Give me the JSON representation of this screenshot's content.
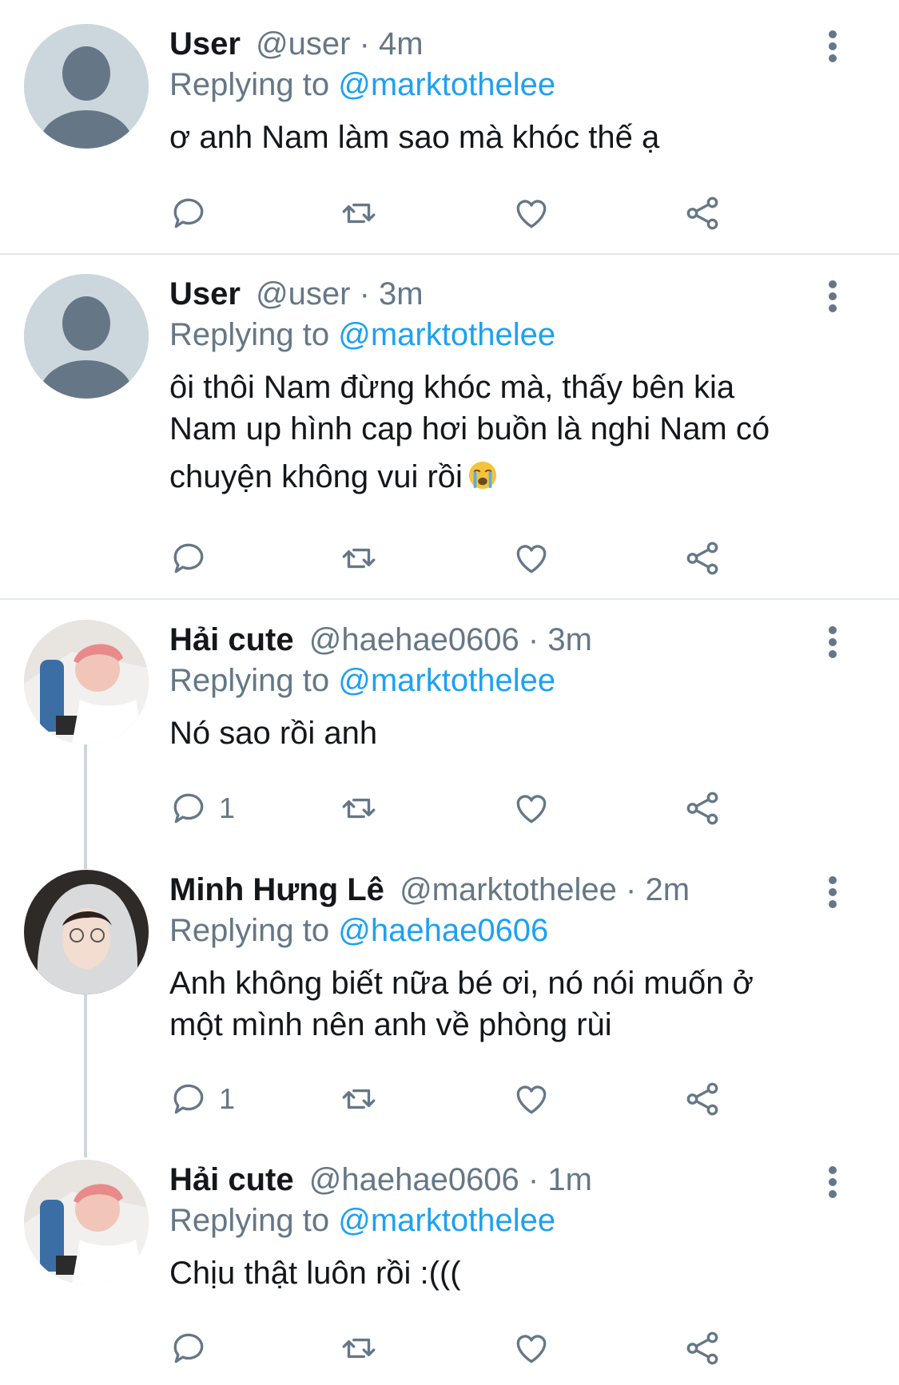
{
  "colors": {
    "mention": "#1da1f2",
    "secondary": "#657786",
    "divider": "#e1e8ed",
    "thread_line": "#ccd6dd"
  },
  "tweets": [
    {
      "name": "User",
      "handle": "@user",
      "sep": " · ",
      "time": "4m",
      "replying_prefix": "Replying to ",
      "replying_to": "@marktothelee",
      "text_lines": [
        "ơ anh Nam làm sao mà khóc thế ạ"
      ],
      "reply_count": "",
      "avatar_icon": "default-avatar-icon"
    },
    {
      "name": "User",
      "handle": "@user",
      "sep": " · ",
      "time": "3m",
      "replying_prefix": "Replying to ",
      "replying_to": "@marktothelee",
      "text_lines": [
        "ôi thôi Nam đừng khóc mà, thấy bên kia",
        "Nam up hình cap hơi buồn là nghi Nam có",
        "chuyện không vui rồi"
      ],
      "emoji": "loudly-crying-face-emoji",
      "reply_count": "",
      "avatar_icon": "default-avatar-icon"
    },
    {
      "name": "Hải cute",
      "handle": "@haehae0606",
      "sep": " · ",
      "time": "3m",
      "replying_prefix": "Replying to ",
      "replying_to": "@marktothelee",
      "text_lines": [
        "Nó sao rồi anh"
      ],
      "reply_count": "1",
      "avatar_icon": "photo-avatar"
    },
    {
      "name": "Minh Hưng Lê",
      "handle": "@marktothelee",
      "sep": " · ",
      "time": "2m",
      "replying_prefix": "Replying to ",
      "replying_to": "@haehae0606",
      "text_lines": [
        "Anh không biết nữa bé ơi, nó nói muốn ở",
        "một mình nên anh về phòng rùi"
      ],
      "reply_count": "1",
      "avatar_icon": "photo-avatar"
    },
    {
      "name": "Hải cute",
      "handle": "@haehae0606",
      "sep": " · ",
      "time": "1m",
      "replying_prefix": "Replying to ",
      "replying_to": "@marktothelee",
      "text_lines": [
        "Chịu thật luôn rồi :((("
      ],
      "reply_count": "",
      "avatar_icon": "photo-avatar"
    }
  ]
}
